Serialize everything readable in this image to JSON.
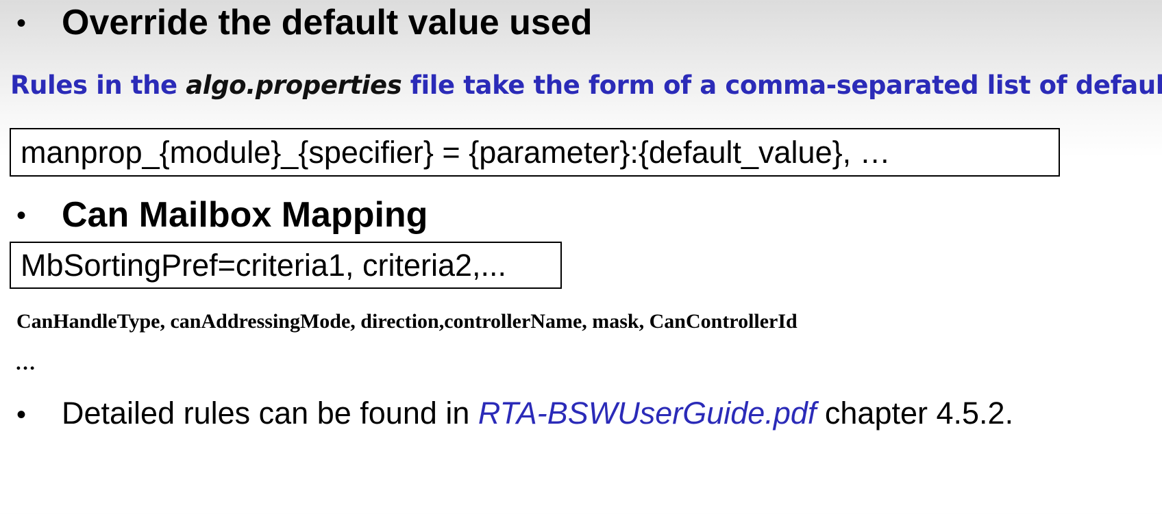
{
  "bullets": {
    "glyph": "•"
  },
  "section_override": {
    "heading": "Override the default value used"
  },
  "rules_line": {
    "prefix": "Rules in the ",
    "file_name": "algo.properties",
    "suffix": " file take the form of a comma-separated list of defaults",
    "color": "#2b2bb8"
  },
  "syntax_box": {
    "text": "manprop_{module}_{specifier} = {parameter}:{default_value}, …"
  },
  "section_mailbox": {
    "heading": "Can Mailbox Mapping"
  },
  "mailbox_box": {
    "text": "MbSortingPref=criteria1, criteria2,..."
  },
  "criteria_line": {
    "text": "CanHandleType, canAddressingMode, direction,controllerName, mask, CanControllerId"
  },
  "continuation": {
    "text": "…"
  },
  "detail_line": {
    "prefix": "Detailed rules can be found in ",
    "document": "RTA-BSWUserGuide.pdf",
    "suffix": " chapter 4.5.2.",
    "link_color": "#2b2bb8"
  }
}
